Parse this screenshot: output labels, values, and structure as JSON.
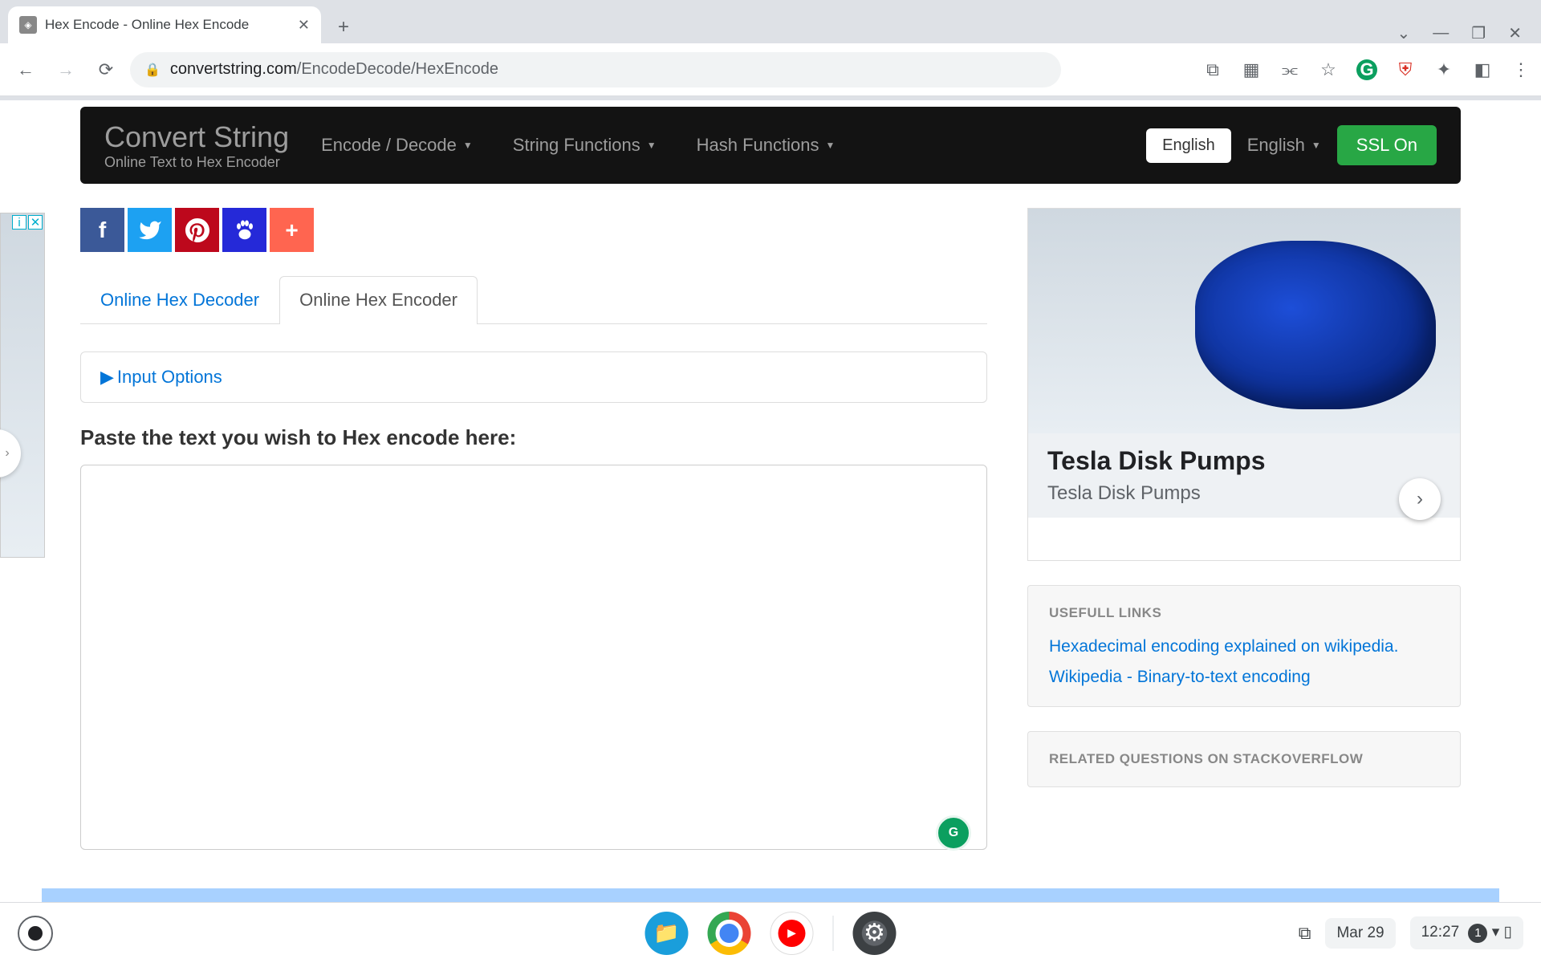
{
  "browser": {
    "tab_title": "Hex Encode - Online Hex Encode",
    "url_domain": "convertstring.com",
    "url_path": "/EncodeDecode/HexEncode"
  },
  "navbar": {
    "brand": "Convert String",
    "subtitle": "Online Text to Hex Encoder",
    "menu1": "Encode / Decode",
    "menu2": "String Functions",
    "menu3": "Hash Functions",
    "lang_btn": "English",
    "lang_drop": "English",
    "ssl": "SSL On"
  },
  "social": {
    "fb": "f",
    "tw": "t",
    "pin": "p",
    "baidu": "B",
    "plus": "+"
  },
  "tabs": {
    "decoder": "Online Hex Decoder",
    "encoder": "Online Hex Encoder"
  },
  "input_options": "Input Options",
  "prompt": "Paste the text you wish to Hex encode here:",
  "textarea_value": "",
  "ad": {
    "title": "Tesla Disk Pumps",
    "sub": "Tesla Disk Pumps"
  },
  "links_panel": {
    "heading": "USEFULL LINKS",
    "link1": "Hexadecimal encoding explained on wikipedia.",
    "link2": "Wikipedia - Binary-to-text encoding"
  },
  "so_panel": {
    "heading": "RELATED QUESTIONS ON STACKOVERFLOW"
  },
  "taskbar": {
    "date": "Mar 29",
    "time": "12:27",
    "notif": "1"
  }
}
